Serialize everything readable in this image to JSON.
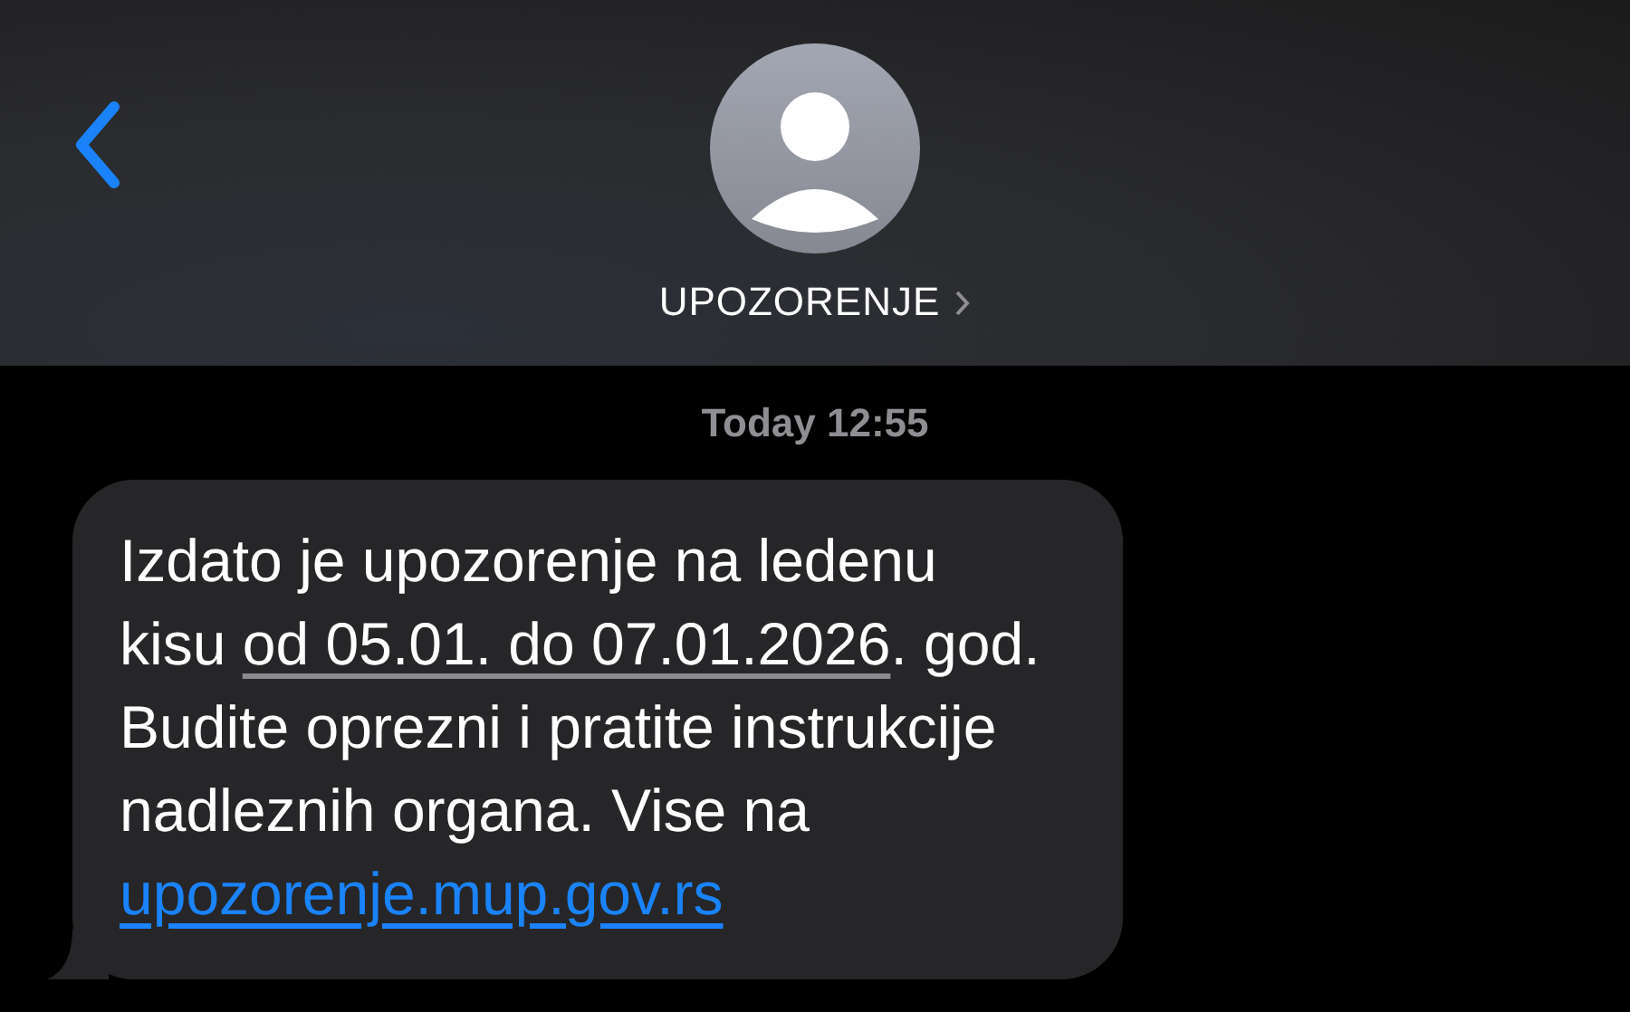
{
  "header": {
    "contact_name": "UPOZORENJE"
  },
  "timestamp": "Today 12:55",
  "message": {
    "parts": [
      {
        "kind": "text",
        "text": "Izdato je upozorenje na ledenu\nkisu "
      },
      {
        "kind": "date",
        "text": "od 05.01. do 07.01.2026"
      },
      {
        "kind": "text",
        "text": ". god.\nBudite oprezni i pratite instrukcije\nnadleznih organa. Vise na\n"
      },
      {
        "kind": "link",
        "text": "upozorenje.mup.gov.rs"
      }
    ]
  }
}
